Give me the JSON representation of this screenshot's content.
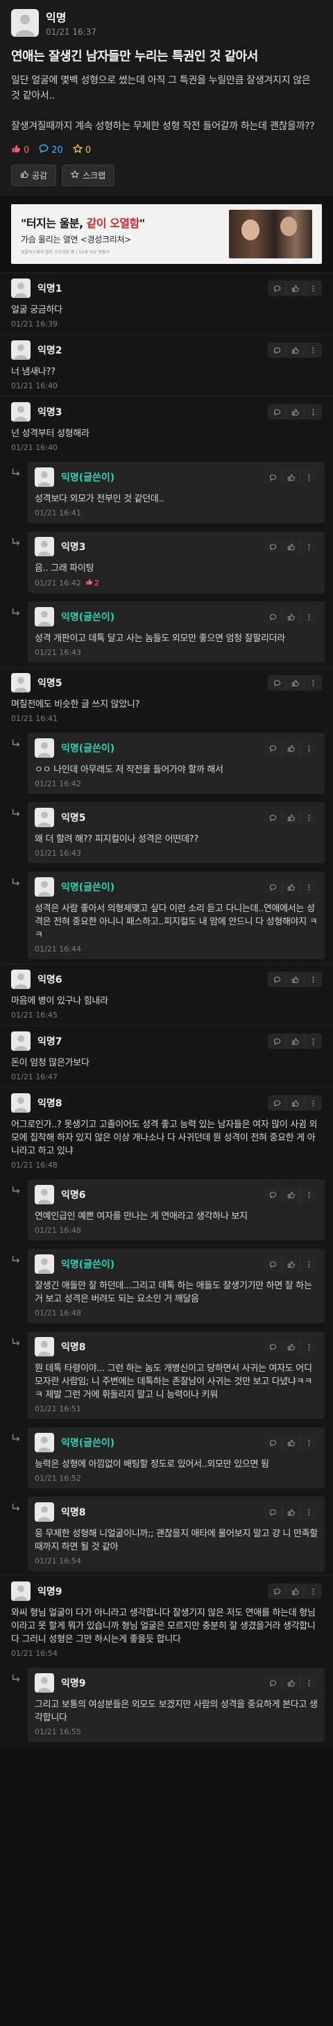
{
  "post": {
    "author": "익명",
    "date": "01/21 16:37",
    "title": "연애는 잘생긴 남자들만 누리는 특권인 것 같아서",
    "body": [
      "일단 얼굴에 몇백 성형으로 썼는데 아직 그 특권을 누릴만큼 잘생겨지지 않은 것 같아서..",
      "",
      "잘생겨질때까지 계속 성형하는 무제한 성형 작전 들어갈까 하는데 괜찮을까??"
    ],
    "likes": "0",
    "comments": "20",
    "scraps": "0",
    "like_button": "공감",
    "scrap_button": "스크랩"
  },
  "ad": {
    "headline_pre": "\"터지는 울분, ",
    "headline_red": "같이 오열함",
    "headline_post": "\"",
    "sub": "가슴 울리는 열연 <경성크리처>",
    "fine": "넷플릭스에서 절찬 스트리밍 중 | 15세 이상 관람가"
  },
  "comments": [
    {
      "name": "익명1",
      "text": "얼굴 궁금하다",
      "date": "01/21 16:39",
      "reply": false,
      "op": false
    },
    {
      "name": "익명2",
      "text": "너 냄새나??",
      "date": "01/21 16:40",
      "reply": false,
      "op": false
    },
    {
      "name": "익명3",
      "text": "넌 성격부터 성형해라",
      "date": "01/21 16:40",
      "reply": false,
      "op": false
    },
    {
      "name": "익명(글쓴이)",
      "text": "성격보다 외모가 전부인 것 같던데..",
      "date": "01/21 16:41",
      "reply": true,
      "op": true
    },
    {
      "name": "익명3",
      "text": "음.. 그래 파이팅",
      "date": "01/21 16:42",
      "reply": true,
      "op": false,
      "likes": "2"
    },
    {
      "name": "익명(글쓴이)",
      "text": "성격 개판이고 데톡 달고 사는 놈들도 외모만 좋으면 엄청 잘팔리더라",
      "date": "01/21 16:43",
      "reply": true,
      "op": true
    },
    {
      "name": "익명5",
      "text": "며칠전에도 비슷한 글 쓰지 않았니?",
      "date": "01/21 16:41",
      "reply": false,
      "op": false
    },
    {
      "name": "익명(글쓴이)",
      "text": "ㅇㅇ 나인데 아무래도 저 작전을 들어가야 할까 해서",
      "date": "01/21 16:42",
      "reply": true,
      "op": true
    },
    {
      "name": "익명5",
      "text": "왜 더 할려 해?? 피지컬이나 성격은 어떤데??",
      "date": "01/21 16:43",
      "reply": true,
      "op": false
    },
    {
      "name": "익명(글쓴이)",
      "text": "성격은 사람 좋아서 의형제맺고 싶다 이런 소리 듣고 다니는데..연애에서는 성격은 전혀 중요한 아니니 패스하고..피지컬도 내 맘에 안드니 다 성형해야지 ㅋㅋ",
      "date": "01/21 16:44",
      "reply": true,
      "op": true
    },
    {
      "name": "익명6",
      "text": "마음에 병이 있구나 힘내라",
      "date": "01/21 16:45",
      "reply": false,
      "op": false
    },
    {
      "name": "익명7",
      "text": "돈이 엄청 많은가보다",
      "date": "01/21 16:47",
      "reply": false,
      "op": false
    },
    {
      "name": "익명8",
      "text": "어그로인가..? 못생기고 고졸이어도 성격 좋고 능력 있는 남자들은 여자 많이 사귐 외모에 집착해 하자 있지 않은 이상 개나소나 다 사귀던데 뭔 성격이 전혀 중요한 게 아니라고 하고 있냐",
      "date": "01/21 16:48",
      "reply": false,
      "op": false
    },
    {
      "name": "익명6",
      "text": "연예인급인 예쁜 여자를 만나는 게 연애라고 생각하나 보지",
      "date": "01/21 16:48",
      "reply": true,
      "op": false
    },
    {
      "name": "익명(글쓴이)",
      "text": "잘생긴 애들만 잘 하던데...그리고 데톡 하는 애들도 잘생기기만 하면 잘 하는 거 보고 성격은 버려도 되는 요소인 거 깨달음",
      "date": "01/21 16:48",
      "reply": true,
      "op": true
    },
    {
      "name": "익명8",
      "text": "뭔 데톡 타령이야... 그런 하는 놈도 개병신이고 당하면서 사귀는 여자도 어디 모자란 사람임; 니 주변에는 데톡하는 존잘남이 사귀는 것만 보고 다녔냐ㅋㅋㅋ 제발 그런 거에 휘둘리지 말고 니 능력이나 키워",
      "date": "01/21 16:51",
      "reply": true,
      "op": false
    },
    {
      "name": "익명(글쓴이)",
      "text": "능력은 성형에 아낌없이 배팅할 정도로 있어서..외모만 있으면 됨",
      "date": "01/21 16:52",
      "reply": true,
      "op": true
    },
    {
      "name": "익명8",
      "text": "응 무제한 성형해 니얼굴이니까;; 괜찮을지 애타에 물어보지 말고 걍 니 만족할 때까지 하면 될 것 같아",
      "date": "01/21 16:54",
      "reply": true,
      "op": false
    },
    {
      "name": "익명9",
      "text": "와씨 형님 얼굴이 다가 아니라고 생각합니다 잘생기지 않은 저도 연애를 하는데 형님이라고 못 할게 뭐가 있습니까 형님 얼굴은 모르지만 충분히 잘 생겼을거라 생각합니다 그러니 성형은 그만 하시는게 좋을듯 합니다",
      "date": "01/21 16:54",
      "reply": false,
      "op": false
    },
    {
      "name": "익명9",
      "text": "그리고 보통의 여성분들은 외모도 보겠지만 사람의 성격을 중요하게 본다고 생각합니다",
      "date": "01/21 16:55",
      "reply": true,
      "op": false
    }
  ],
  "colors": {
    "background": "#121212",
    "op_name": "#2fd3b0",
    "like": "#ff5f6d",
    "comment": "#36b3ff",
    "scrap": "#f2c94c"
  },
  "icons": {
    "like": "thumbs-up-icon",
    "comment": "speech-bubble-icon",
    "scrap": "star-icon",
    "reply": "reply-arrow-icon",
    "more": "more-vertical-icon"
  }
}
